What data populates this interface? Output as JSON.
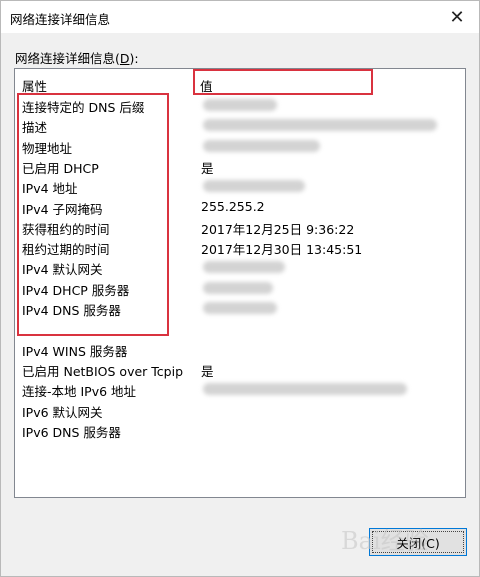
{
  "window": {
    "title": "网络连接详细信息",
    "close_glyph": "✕"
  },
  "section_label": "网络连接详细信息(",
  "section_label_mnemonic": "D",
  "section_label_suffix": "):",
  "list": {
    "headers": {
      "property": "属性",
      "value": "值"
    },
    "rows": [
      {
        "name": "连接特定的 DNS 后缀",
        "value": "",
        "blur": [
          188,
          262
        ]
      },
      {
        "name": "描述",
        "value": "",
        "blur": [
          188,
          422
        ]
      },
      {
        "name": "物理地址",
        "value": "",
        "blur": [
          188,
          305
        ]
      },
      {
        "name": "已启用 DHCP",
        "value": "是"
      },
      {
        "name": "IPv4 地址",
        "value": "",
        "blur": [
          188,
          290
        ]
      },
      {
        "name": "IPv4 子网掩码",
        "value": "255.255.2"
      },
      {
        "name": "获得租约的时间",
        "value": "2017年12月25日 9:36:22"
      },
      {
        "name": "租约过期的时间",
        "value": "2017年12月30日 13:45:51"
      },
      {
        "name": "IPv4 默认网关",
        "value": "",
        "blur": [
          188,
          270
        ]
      },
      {
        "name": "IPv4 DHCP 服务器",
        "value": "",
        "blur": [
          188,
          258
        ]
      },
      {
        "name": "IPv4 DNS 服务器",
        "value": "",
        "blur": [
          188,
          262
        ]
      },
      {
        "name": "",
        "value": ""
      },
      {
        "name": "IPv4 WINS 服务器",
        "value": ""
      },
      {
        "name": "已启用 NetBIOS over Tcpip",
        "value": "是"
      },
      {
        "name": "连接-本地 IPv6 地址",
        "value": "",
        "blur": [
          188,
          392
        ]
      },
      {
        "name": "IPv6 默认网关",
        "value": ""
      },
      {
        "name": "IPv6 DNS 服务器",
        "value": ""
      }
    ]
  },
  "buttons": {
    "close": "关闭(C)"
  },
  "watermark": "Bai经验"
}
